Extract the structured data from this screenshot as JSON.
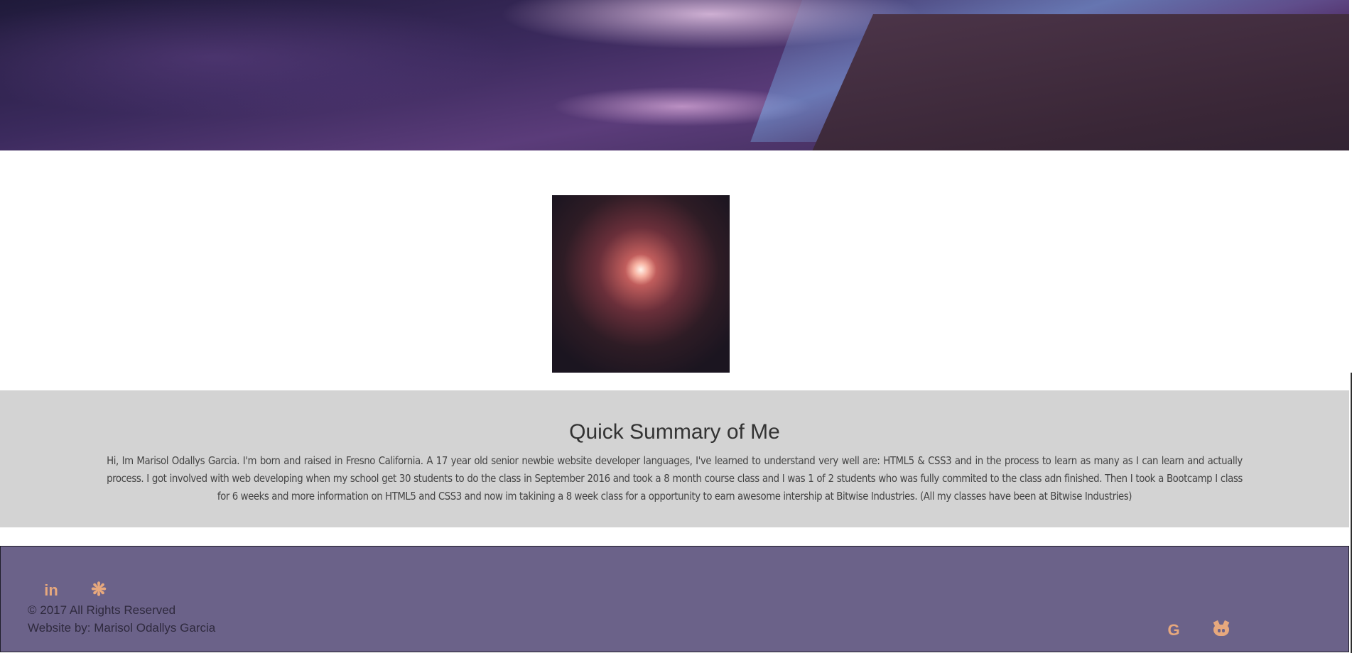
{
  "hero": {
    "description": ""
  },
  "summary": {
    "title": "Quick Summary of Me",
    "body": "Hi, Im Marisol Odallys Garcia. I'm born and raised in Fresno California. A 17 year old senior newbie website developer languages, I've learned to understand very well are: HTML5 & CSS3 and in the process to learn as many as I can learn and actually process. I got involved with web developing when my school get 30 students to do the class in September 2016 and took a 8 month course class and I was 1 of 2 students who was fully commited to the class adn finished. Then I took a Bootcamp I class for 6 weeks and more information on HTML5 and CSS3 and now im takining a 8 week class for a opportunity to earn awesome intership at Bitwise Industries. (All my classes have been at Bitwise Industries)"
  },
  "footer": {
    "copyright": "© 2017 All Rights Reserved",
    "credit": "Website by: Marisol Odallys Garcia",
    "icons": {
      "linkedin": "in",
      "cog": "❋",
      "google": "G"
    }
  },
  "colors": {
    "footer_bg": "#6b6289",
    "icon_accent": "#e7a87d",
    "summary_bg": "#d3d3d3"
  }
}
